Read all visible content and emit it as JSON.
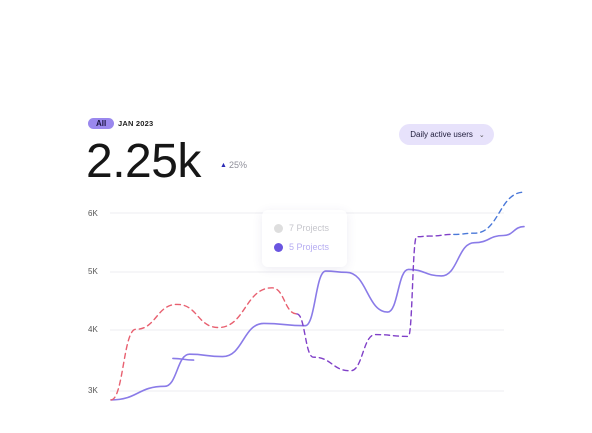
{
  "header": {
    "badge": "All",
    "date": "JAN 2023",
    "metric_value": "2.25k",
    "delta_text": "25%",
    "delta_direction": "up"
  },
  "dropdown": {
    "label": "Daily active users"
  },
  "tooltip": {
    "rows": [
      {
        "label": "7 Projects",
        "color": "#dedede"
      },
      {
        "label": "5 Projects",
        "color": "#6a55e0"
      }
    ]
  },
  "colors": {
    "accent": "#9a88ee",
    "series_solid": "#8a7be8",
    "series_dashed_red": "#e86070",
    "series_dashed_purple": "#8040c8",
    "series_dashed_blue": "#4a78d8"
  },
  "chart_data": {
    "type": "line",
    "y_tick_labels": [
      "6K",
      "5K",
      "4K",
      "3K"
    ],
    "ylim": [
      2800,
      6400
    ],
    "grid": true,
    "series": [
      {
        "style": "solid",
        "color": "#8a7be8",
        "x": [
          0,
          13,
          19,
          27,
          37,
          47,
          52,
          57,
          67,
          72,
          80,
          88,
          95,
          100
        ],
        "y": [
          2850,
          3080,
          3620,
          3580,
          4140,
          4100,
          5020,
          5000,
          4330,
          5050,
          4940,
          5500,
          5620,
          5770
        ]
      },
      {
        "style": "solid",
        "color": "#8a7be8",
        "x": [
          15,
          20
        ],
        "y": [
          3550,
          3520
        ]
      },
      {
        "style": "dashed",
        "color": "#e86070",
        "x": [
          0,
          6,
          16,
          26,
          39,
          45
        ],
        "y": [
          2850,
          4040,
          4460,
          4070,
          4740,
          4300
        ]
      },
      {
        "style": "dashed",
        "color": "#8040c8",
        "x": [
          45,
          49,
          58,
          64,
          72,
          74,
          77,
          83
        ],
        "y": [
          4300,
          3570,
          3340,
          3950,
          3920,
          5600,
          5610,
          5640
        ]
      },
      {
        "style": "dashed",
        "color": "#4a78d8",
        "x": [
          83,
          88,
          100
        ],
        "y": [
          5640,
          5660,
          6350
        ]
      }
    ]
  }
}
